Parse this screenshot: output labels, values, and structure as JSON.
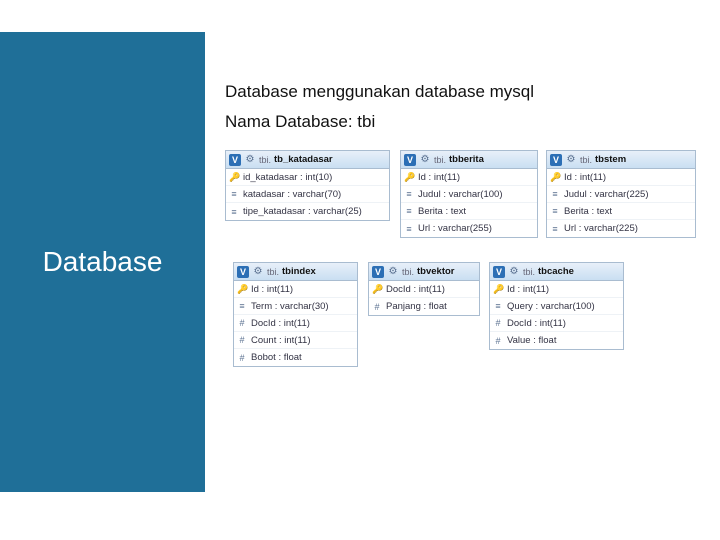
{
  "sidebar": {
    "title": "Database"
  },
  "content": {
    "desc": "Database menggunakan database mysql",
    "name_line": "Nama Database: tbi"
  },
  "tables": [
    {
      "id": "t0",
      "schema": "tbi.",
      "name": "tb_katadasar",
      "cols": [
        {
          "icon": "pk",
          "text": "id_katadasar : int(10)"
        },
        {
          "icon": "txt",
          "text": "katadasar : varchar(70)"
        },
        {
          "icon": "txt",
          "text": "tipe_katadasar : varchar(25)"
        }
      ]
    },
    {
      "id": "t1",
      "schema": "tbi.",
      "name": "tbberita",
      "cols": [
        {
          "icon": "pk",
          "text": "Id : int(11)"
        },
        {
          "icon": "txt",
          "text": "Judul : varchar(100)"
        },
        {
          "icon": "txt",
          "text": "Berita : text"
        },
        {
          "icon": "txt",
          "text": "Url : varchar(255)"
        }
      ]
    },
    {
      "id": "t2",
      "schema": "tbi.",
      "name": "tbstem",
      "cols": [
        {
          "icon": "pk",
          "text": "Id : int(11)"
        },
        {
          "icon": "txt",
          "text": "Judul : varchar(225)"
        },
        {
          "icon": "txt",
          "text": "Berita : text"
        },
        {
          "icon": "txt",
          "text": "Url : varchar(225)"
        }
      ]
    },
    {
      "id": "t3",
      "schema": "tbi.",
      "name": "tbindex",
      "cols": [
        {
          "icon": "pk",
          "text": "Id : int(11)"
        },
        {
          "icon": "txt",
          "text": "Term : varchar(30)"
        },
        {
          "icon": "num",
          "text": "DocId : int(11)"
        },
        {
          "icon": "num",
          "text": "Count : int(11)"
        },
        {
          "icon": "num",
          "text": "Bobot : float"
        }
      ]
    },
    {
      "id": "t4",
      "schema": "tbi.",
      "name": "tbvektor",
      "cols": [
        {
          "icon": "pk",
          "text": "DocId : int(11)"
        },
        {
          "icon": "num",
          "text": "Panjang : float"
        }
      ]
    },
    {
      "id": "t5",
      "schema": "tbi.",
      "name": "tbcache",
      "cols": [
        {
          "icon": "pk",
          "text": "Id : int(11)"
        },
        {
          "icon": "txt",
          "text": "Query : varchar(100)"
        },
        {
          "icon": "num",
          "text": "DocId : int(11)"
        },
        {
          "icon": "num",
          "text": "Value : float"
        }
      ]
    }
  ]
}
